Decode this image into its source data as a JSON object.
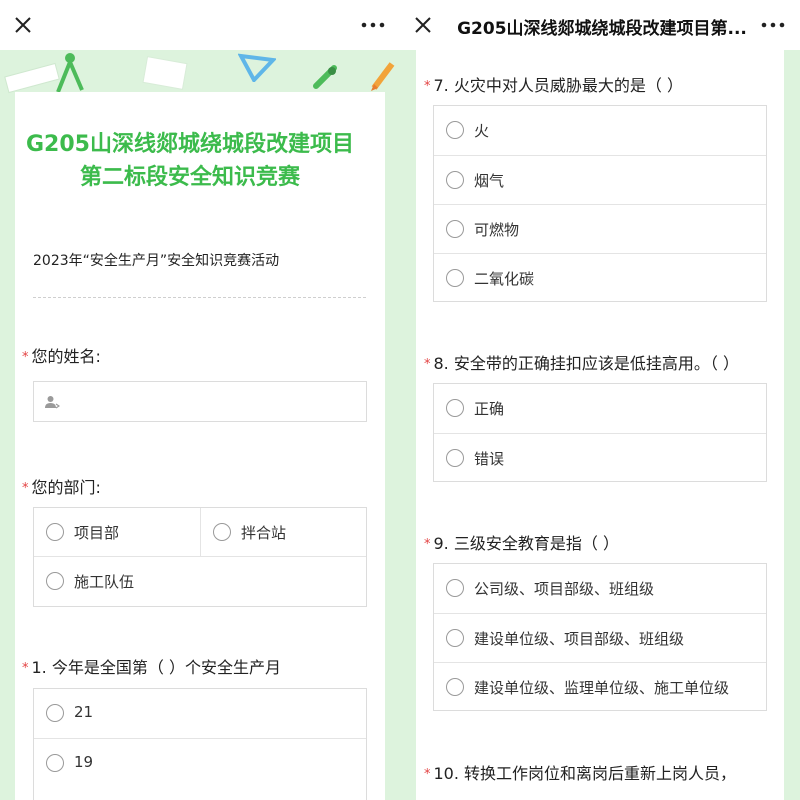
{
  "left": {
    "form_title": "G205山深线郯城绕城段改建项目第二标段安全知识竞赛",
    "subtitle": "2023年“安全生产月”安全知识竞赛活动",
    "name_question": "您的姓名:",
    "dept_question": "您的部门:",
    "dept_options": [
      "项目部",
      "拌合站",
      "施工队伍"
    ],
    "q1": {
      "text": "1. 今年是全国第（ ）个安全生产月",
      "options": [
        "21",
        "19"
      ]
    }
  },
  "right": {
    "title": "G205山深线郯城绕城段改建项目第...",
    "q7": {
      "text": "7. 火灾中对人员威胁最大的是（ ）",
      "options": [
        "火",
        "烟气",
        "可燃物",
        "二氧化碳"
      ]
    },
    "q8": {
      "text": "8. 安全带的正确挂扣应该是低挂高用。（ ）",
      "options": [
        "正确",
        "错误"
      ]
    },
    "q9": {
      "text": "9. 三级安全教育是指（ ）",
      "options": [
        "公司级、项目部级、班组级",
        "建设单位级、项目部级、班组级",
        "建设单位级、监理单位级、施工单位级"
      ]
    },
    "q10": {
      "text": "10. 转换工作岗位和离岗后重新上岗人员，"
    }
  },
  "icons": {
    "close": "close-icon",
    "more": "more-dots-icon",
    "person": "person-icon"
  },
  "colors": {
    "title_green": "#3cbb4c",
    "required_star": "#e34141",
    "background_green": "#ddf3dd"
  }
}
